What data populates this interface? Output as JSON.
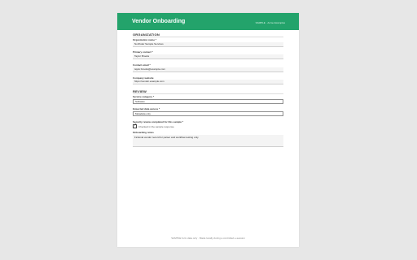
{
  "header": {
    "title": "Vendor Onboarding",
    "tagline": "SAMPLE · Acme Examples"
  },
  "organization": {
    "heading": "ORGANIZATION",
    "fields": [
      {
        "label": "Organization name *",
        "value": "Northstar Sample Services"
      },
      {
        "label": "Primary contact *",
        "value": "Taylor Brooks"
      },
      {
        "label": "Contact email *",
        "value": "taylor.brooks@example.com"
      },
      {
        "label": "Company website",
        "value": "https://vendor.example.com"
      }
    ]
  },
  "review": {
    "heading": "REVIEW",
    "service_category": {
      "label": "Service category *",
      "value": "Software"
    },
    "data_access": {
      "label": "Expected data access *",
      "value": "Metadata only"
    },
    "security": {
      "label": "Security review completed for this sample *",
      "checked": true,
      "checkbox_label": "Checked in the sample response"
    },
    "notes": {
      "label": "Onboarding notes",
      "value": "Fictional vendor record for parser and workflow testing only."
    }
  },
  "footer": {
    "text": "SAMPLE form data only · Made locally during a controlled e-session"
  },
  "colors": {
    "header": "#23a36b",
    "field_background": "#f4f4f4",
    "page_background": "#e7e7e7"
  }
}
